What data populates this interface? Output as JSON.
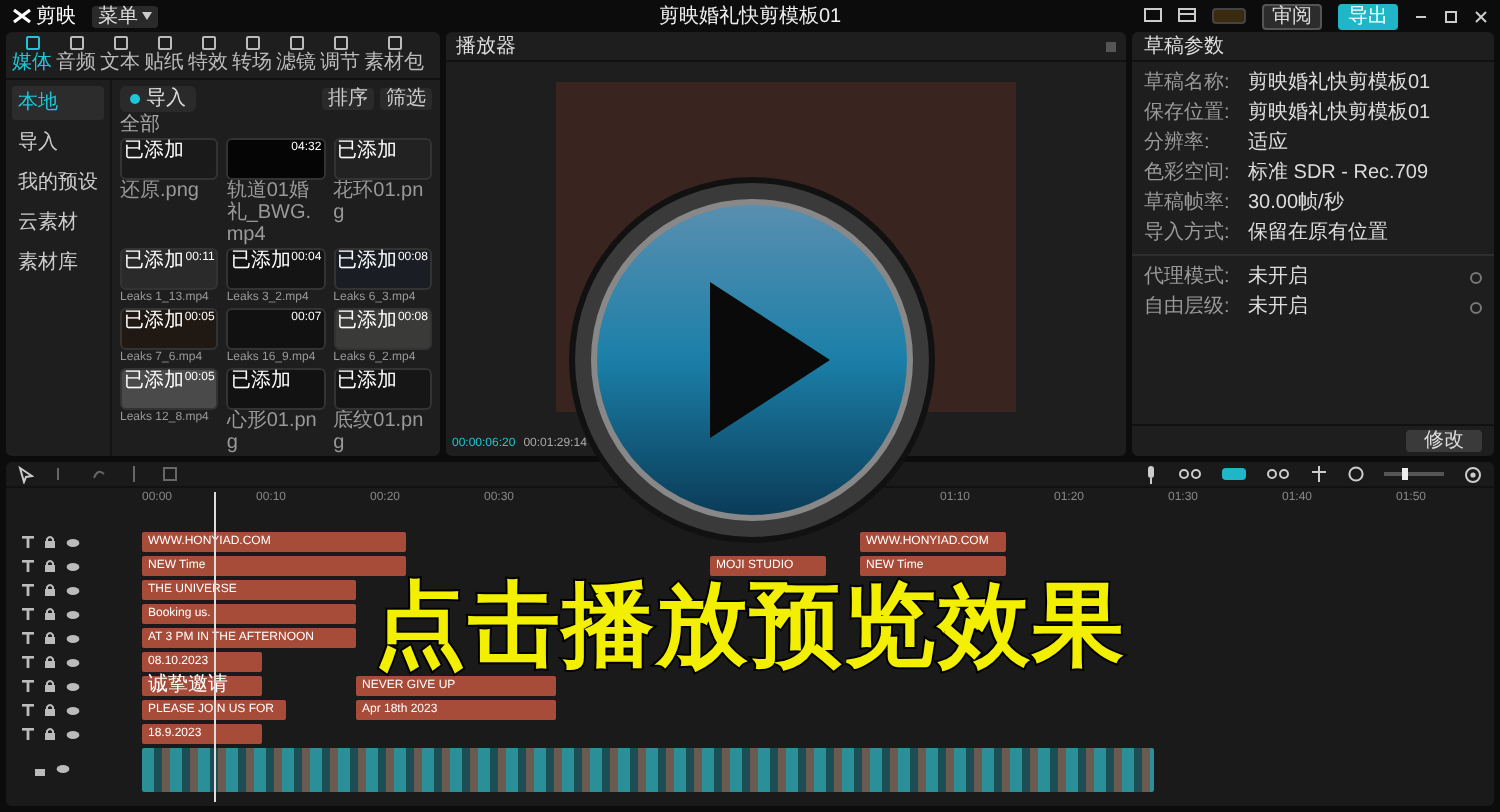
{
  "topbar": {
    "app_name": "剪映",
    "menu": "菜单",
    "title": "剪映婚礼快剪模板01",
    "review": "审阅",
    "export": "导出"
  },
  "tool_tabs": [
    {
      "label": "媒体",
      "selected": true
    },
    {
      "label": "音频",
      "selected": false
    },
    {
      "label": "文本",
      "selected": false
    },
    {
      "label": "贴纸",
      "selected": false
    },
    {
      "label": "特效",
      "selected": false
    },
    {
      "label": "转场",
      "selected": false
    },
    {
      "label": "滤镜",
      "selected": false
    },
    {
      "label": "调节",
      "selected": false
    },
    {
      "label": "素材包",
      "selected": false
    }
  ],
  "sidebar": {
    "items": [
      {
        "label": "本地",
        "selected": true
      },
      {
        "label": "导入",
        "selected": false
      },
      {
        "label": "我的预设",
        "selected": false
      },
      {
        "label": "云素材",
        "selected": false
      },
      {
        "label": "素材库",
        "selected": false
      }
    ]
  },
  "media": {
    "import": "导入",
    "sort": "排序",
    "filter": "筛选",
    "section": "全部",
    "items": [
      {
        "name": "还原.png",
        "added": "已添加"
      },
      {
        "name": "轨道01婚礼_BWG.mp4",
        "duration": "04:32"
      },
      {
        "name": "花环01.png",
        "added": "已添加"
      },
      {
        "name": "Leaks 1_13.mp4",
        "added": "已添加",
        "duration": "00:11"
      },
      {
        "name": "Leaks 3_2.mp4",
        "added": "已添加",
        "duration": "00:04"
      },
      {
        "name": "Leaks 6_3.mp4",
        "added": "已添加",
        "duration": "00:08"
      },
      {
        "name": "Leaks 7_6.mp4",
        "added": "已添加",
        "duration": "00:05"
      },
      {
        "name": "Leaks 16_9.mp4",
        "duration": "00:07"
      },
      {
        "name": "Leaks 6_2.mp4",
        "added": "已添加",
        "duration": "00:08"
      },
      {
        "name": "Leaks 12_8.mp4",
        "added": "已添加",
        "duration": "00:05"
      },
      {
        "name": "心形01.png",
        "added": "已添加"
      },
      {
        "name": "底纹01.png",
        "added": "已添加"
      }
    ]
  },
  "player": {
    "title": "播放器",
    "current_time": "00:00:06:20",
    "total_time": "00:01:29:14"
  },
  "draft_panel": {
    "title": "草稿参数",
    "fields": [
      {
        "label": "草稿名称:",
        "value": "剪映婚礼快剪模板01"
      },
      {
        "label": "保存位置:",
        "value": "剪映婚礼快剪模板01"
      },
      {
        "label": "分辨率:",
        "value": "适应"
      },
      {
        "label": "色彩空间:",
        "value": "标准 SDR - Rec.709"
      },
      {
        "label": "草稿帧率:",
        "value": "30.00帧/秒"
      },
      {
        "label": "导入方式:",
        "value": "保留在原有位置"
      }
    ],
    "settings": [
      {
        "label": "代理模式:",
        "value": "未开启"
      },
      {
        "label": "自由层级:",
        "value": "未开启"
      }
    ],
    "modify": "修改"
  },
  "timeline": {
    "zoom_slider": {
      "level": 0.35
    },
    "ticks": [
      "00:00",
      "00:10",
      "00:20",
      "00:30",
      "01:10",
      "01:20",
      "01:30",
      "01:40",
      "01:50"
    ],
    "tracks": [
      {
        "clips": [
          "WWW.HONYIAD.COM",
          "WWW.HONYIAD.COM"
        ]
      },
      {
        "clips": [
          "NEW Time",
          "MOJI STUDIO",
          "NEW Time"
        ]
      },
      {
        "clips": [
          "THE UNIVERSE"
        ]
      },
      {
        "clips": [
          "Booking us."
        ]
      },
      {
        "clips": [
          "AT 3 PM IN THE AFTERNOON"
        ]
      },
      {
        "clips": [
          "08.10.2023"
        ]
      },
      {
        "clips": [
          "诚挚邀请",
          "NEVER GIVE UP"
        ]
      },
      {
        "clips": [
          "PLEASE JOIN US FOR",
          "Apr 18th 2023"
        ]
      },
      {
        "clips": [
          "18.9.2023"
        ]
      }
    ]
  },
  "overlay": {
    "caption": "点击播放预览效果"
  }
}
